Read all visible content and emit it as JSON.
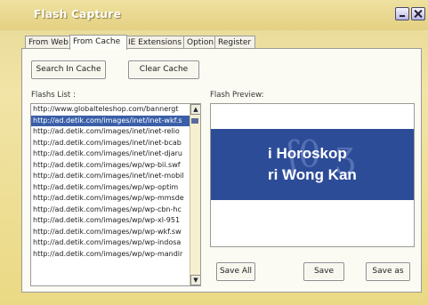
{
  "window": {
    "title": "Flash Capture"
  },
  "tabs": [
    {
      "label": "From Web"
    },
    {
      "label": "From Cache"
    },
    {
      "label": "IE Extensions"
    },
    {
      "label": "Option"
    },
    {
      "label": "Register"
    }
  ],
  "cache_panel": {
    "search_button": "Search In Cache",
    "clear_button": "Clear Cache",
    "list_label": "Flashs List :",
    "preview_label": "Flash Preview:",
    "flashes": [
      "http://www.globalteleshop.com/bannergt",
      "http://ad.detik.com/images/inet/inet-wkf.s",
      "http://ad.detik.com/images/inet/inet-relio",
      "http://ad.detik.com/images/inet/inet-bcab",
      "http://ad.detik.com/images/inet/inet-djaru",
      "http://ad.detik.com/images/wp/wp-bii.swf",
      "http://ad.detik.com/images/inet/inet-mobil",
      "http://ad.detik.com/images/wp/wp-optim",
      "http://ad.detik.com/images/wp/wp-mmsde",
      "http://ad.detik.com/images/wp/wp-cbn-hc",
      "http://ad.detik.com/images/wp/wp-xl-951",
      "http://ad.detik.com/images/wp/wp-wkf.sw",
      "http://ad.detik.com/images/wp/wp-indosa",
      "http://ad.detik.com/images/wp/wp-mandir"
    ],
    "selected_index": 1,
    "preview_text": {
      "line1": "i Horoskop",
      "line2": "ri Wong Kan"
    },
    "save_all_button": "Save All",
    "save_button": "Save",
    "save_as_button": "Save as"
  },
  "colors": {
    "accent": "#3a5fa8",
    "banner": "#2d4c98",
    "frame": "#f1e4a6"
  }
}
